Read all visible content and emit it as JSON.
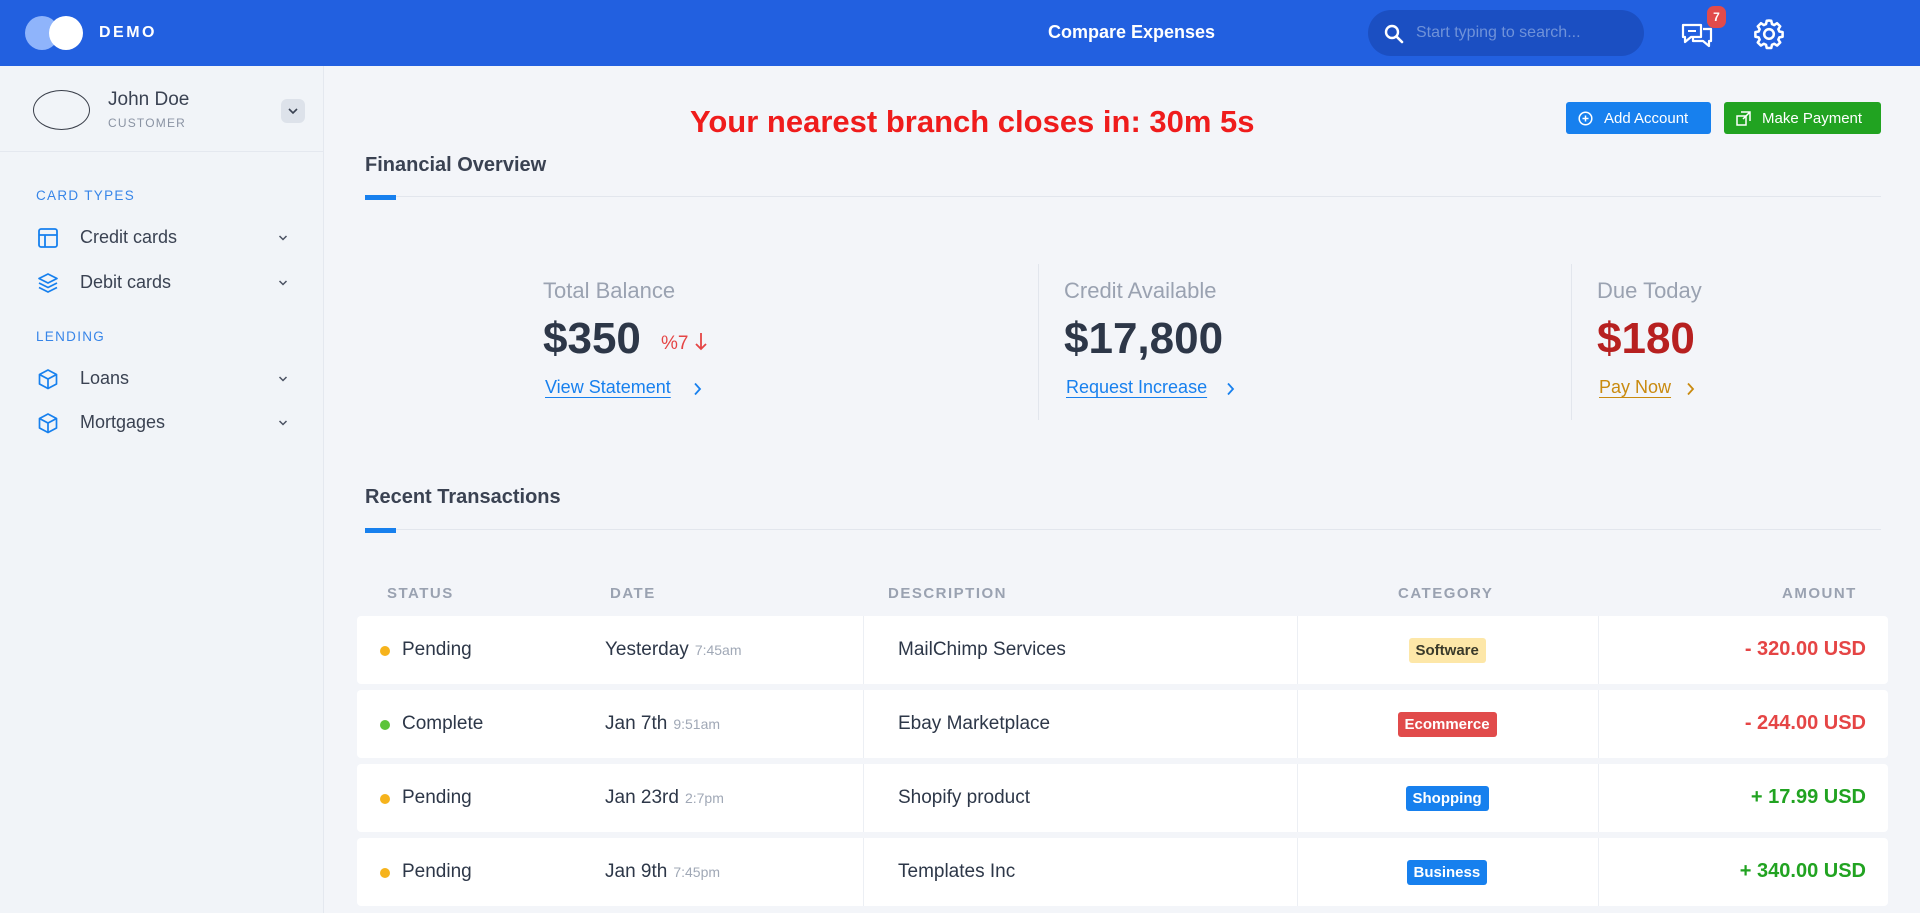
{
  "header": {
    "brand": "DEMO",
    "title": "Compare Expenses",
    "search_placeholder": "Start typing to search...",
    "chat_count": "7"
  },
  "user": {
    "name": "John Doe",
    "role": "CUSTOMER"
  },
  "sidebar": {
    "groups": [
      {
        "title": "CARD TYPES",
        "items": [
          {
            "label": "Credit cards",
            "icon": "layout-icon"
          },
          {
            "label": "Debit cards",
            "icon": "layers-icon"
          }
        ]
      },
      {
        "title": "LENDING",
        "items": [
          {
            "label": "Loans",
            "icon": "box-icon"
          },
          {
            "label": "Mortgages",
            "icon": "box-icon"
          }
        ]
      }
    ]
  },
  "branch_notice": "Your nearest branch closes in: 30m 5s",
  "actions": {
    "add_account": "Add Account",
    "make_payment": "Make Payment"
  },
  "overview": {
    "title": "Financial Overview",
    "stats": [
      {
        "label": "Total Balance",
        "value": "$350",
        "change": "%7",
        "link": "View Statement",
        "value_color": "#2d3748",
        "link_color": "#1780ee"
      },
      {
        "label": "Credit Available",
        "value": "$17,800",
        "link": "Request Increase",
        "value_color": "#2d3748",
        "link_color": "#1780ee"
      },
      {
        "label": "Due Today",
        "value": "$180",
        "link": "Pay Now",
        "value_color": "#b72020",
        "link_color": "#c98a0f"
      }
    ]
  },
  "transactions": {
    "title": "Recent Transactions",
    "columns": [
      "STATUS",
      "DATE",
      "DESCRIPTION",
      "CATEGORY",
      "AMOUNT"
    ],
    "rows": [
      {
        "status": "Pending",
        "status_color": "#f6b31c",
        "date": "Yesterday",
        "time": "7:45am",
        "description": "MailChimp Services",
        "category": "Software",
        "category_bg": "#fde7a8",
        "category_fg": "#3a3a2a",
        "amount": "- 320.00 USD",
        "amount_color": "#e54545"
      },
      {
        "status": "Complete",
        "status_color": "#5cc43a",
        "date": "Jan 7th",
        "time": "9:51am",
        "description": "Ebay Marketplace",
        "category": "Ecommerce",
        "category_bg": "#e14b4b",
        "category_fg": "#ffffff",
        "amount": "- 244.00 USD",
        "amount_color": "#e54545"
      },
      {
        "status": "Pending",
        "status_color": "#f6b31c",
        "date": "Jan 23rd",
        "time": "2:7pm",
        "description": "Shopify product",
        "category": "Shopping",
        "category_bg": "#1780ee",
        "category_fg": "#ffffff",
        "amount": "+ 17.99 USD",
        "amount_color": "#21a321"
      },
      {
        "status": "Pending",
        "status_color": "#f6b31c",
        "date": "Jan 9th",
        "time": "7:45pm",
        "description": "Templates Inc",
        "category": "Business",
        "category_bg": "#1780ee",
        "category_fg": "#ffffff",
        "amount": "+ 340.00 USD",
        "amount_color": "#21a321"
      }
    ]
  }
}
